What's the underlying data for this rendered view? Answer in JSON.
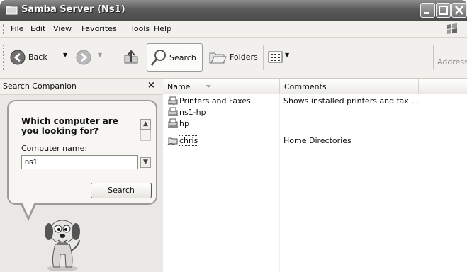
{
  "window": {
    "title": "Samba Server (Ns1)"
  },
  "menu": [
    "File",
    "Edit",
    "View",
    "Favorites",
    "Tools",
    "Help"
  ],
  "toolbar": {
    "back_label": "Back",
    "search_label": "Search",
    "folders_label": "Folders",
    "address_label": "Address"
  },
  "companion": {
    "pane_title": "Search Companion",
    "close_glyph": "×",
    "question": "Which computer are you looking for?",
    "field_label": "Computer name:",
    "field_value": "ns1",
    "search_button": "Search"
  },
  "listing": {
    "columns": {
      "name": "Name",
      "comments": "Comments"
    },
    "rows": [
      {
        "name": "Printers and Faxes",
        "comment": "Shows installed printers and fax ...",
        "icon": "printer-icon"
      },
      {
        "name": "ns1-hp",
        "comment": "",
        "icon": "shared-printer-icon"
      },
      {
        "name": "hp",
        "comment": "",
        "icon": "shared-printer-icon"
      },
      {
        "name": "chris",
        "comment": "Home Directories",
        "icon": "network-share-icon"
      }
    ]
  }
}
